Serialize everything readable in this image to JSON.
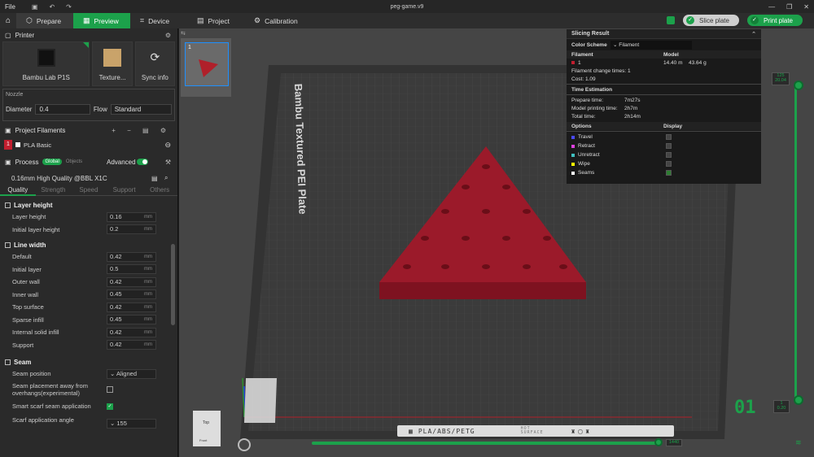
{
  "titlebar": {
    "file_menu": "File",
    "title": "peg-game.v9",
    "controls": [
      "—",
      "❐",
      "✕"
    ]
  },
  "tabs": {
    "prepare": "Prepare",
    "preview": "Preview",
    "device": "Device",
    "project": "Project",
    "calibration": "Calibration"
  },
  "actions": {
    "slice": "Slice plate",
    "print": "Print plate"
  },
  "printer": {
    "section": "Printer",
    "model": "Bambu Lab P1S",
    "plate": "Texture...",
    "sync": "Sync info"
  },
  "nozzle": {
    "label": "Nozzle",
    "diameter_label": "Diameter",
    "diameter_value": "0.4",
    "flow_label": "Flow",
    "flow_value": "Standard"
  },
  "filaments": {
    "section": "Project Filaments",
    "items": [
      {
        "index": "1",
        "name": "PLA Basic",
        "color": "#c21f2f"
      }
    ]
  },
  "process": {
    "section": "Process",
    "global": "Global",
    "objects": "Objects",
    "advanced": "Advanced",
    "profile": "0.16mm High Quality @BBL X1C",
    "subtabs": [
      "Quality",
      "Strength",
      "Speed",
      "Support",
      "Others"
    ]
  },
  "params": {
    "layer_height_group": "Layer height",
    "layer_height": [
      {
        "label": "Layer height",
        "value": "0.16",
        "unit": "mm"
      },
      {
        "label": "Initial layer height",
        "value": "0.2",
        "unit": "mm"
      }
    ],
    "line_width_group": "Line width",
    "line_width": [
      {
        "label": "Default",
        "value": "0.42",
        "unit": "mm"
      },
      {
        "label": "Initial layer",
        "value": "0.5",
        "unit": "mm"
      },
      {
        "label": "Outer wall",
        "value": "0.42",
        "unit": "mm"
      },
      {
        "label": "Inner wall",
        "value": "0.45",
        "unit": "mm"
      },
      {
        "label": "Top surface",
        "value": "0.42",
        "unit": "mm"
      },
      {
        "label": "Sparse infill",
        "value": "0.45",
        "unit": "mm"
      },
      {
        "label": "Internal solid infill",
        "value": "0.42",
        "unit": "mm"
      },
      {
        "label": "Support",
        "value": "0.42",
        "unit": "mm"
      }
    ],
    "seam_group": "Seam",
    "seam_position_label": "Seam position",
    "seam_position_value": "Aligned",
    "seam_away_label": "Seam placement away from overhangs(experimental)",
    "scarf_label": "Smart scarf seam application",
    "scarf_angle_label": "Scarf application angle",
    "scarf_angle_value": "155"
  },
  "viewport": {
    "plate_index": "1",
    "bed_label": "Bambu Textured PEI Plate",
    "bed_bottom": "PLA/ABS/PETG",
    "hot_surface": "HOT SURFACE",
    "plate_number": "01",
    "layer_top": "125",
    "layer_top_h": "20.04",
    "layer_bottom": "1",
    "layer_bottom_h": "0.20",
    "move_value": "1440",
    "view_top": "Top",
    "view_front": "Front"
  },
  "slicing": {
    "title": "Slicing Result",
    "color_scheme_label": "Color Scheme",
    "color_scheme_value": "Filament",
    "filament_col": "Filament",
    "model_col": "Model",
    "filament_row": {
      "index": "1",
      "length": "14.40 m",
      "weight": "43.64 g"
    },
    "change_times_label": "Filament change times:",
    "change_times_value": "1",
    "cost_label": "Cost:",
    "cost_value": "1.09",
    "time_estimation": "Time Estimation",
    "prepare_label": "Prepare time:",
    "prepare_value": "7m27s",
    "model_print_label": "Model printing time:",
    "model_print_value": "2h7m",
    "total_label": "Total time:",
    "total_value": "2h14m",
    "options_col": "Options",
    "display_col": "Display",
    "options": [
      {
        "label": "Travel",
        "color": "#4a4aff",
        "on": false
      },
      {
        "label": "Retract",
        "color": "#e040e0",
        "on": false
      },
      {
        "label": "Unretract",
        "color": "#40c0c0",
        "on": false
      },
      {
        "label": "Wipe",
        "color": "#ffff00",
        "on": false
      },
      {
        "label": "Seams",
        "color": "#ffffff",
        "on": true
      }
    ]
  },
  "colors": {
    "accent": "#1ca14b",
    "model": "#9b1a2a"
  }
}
